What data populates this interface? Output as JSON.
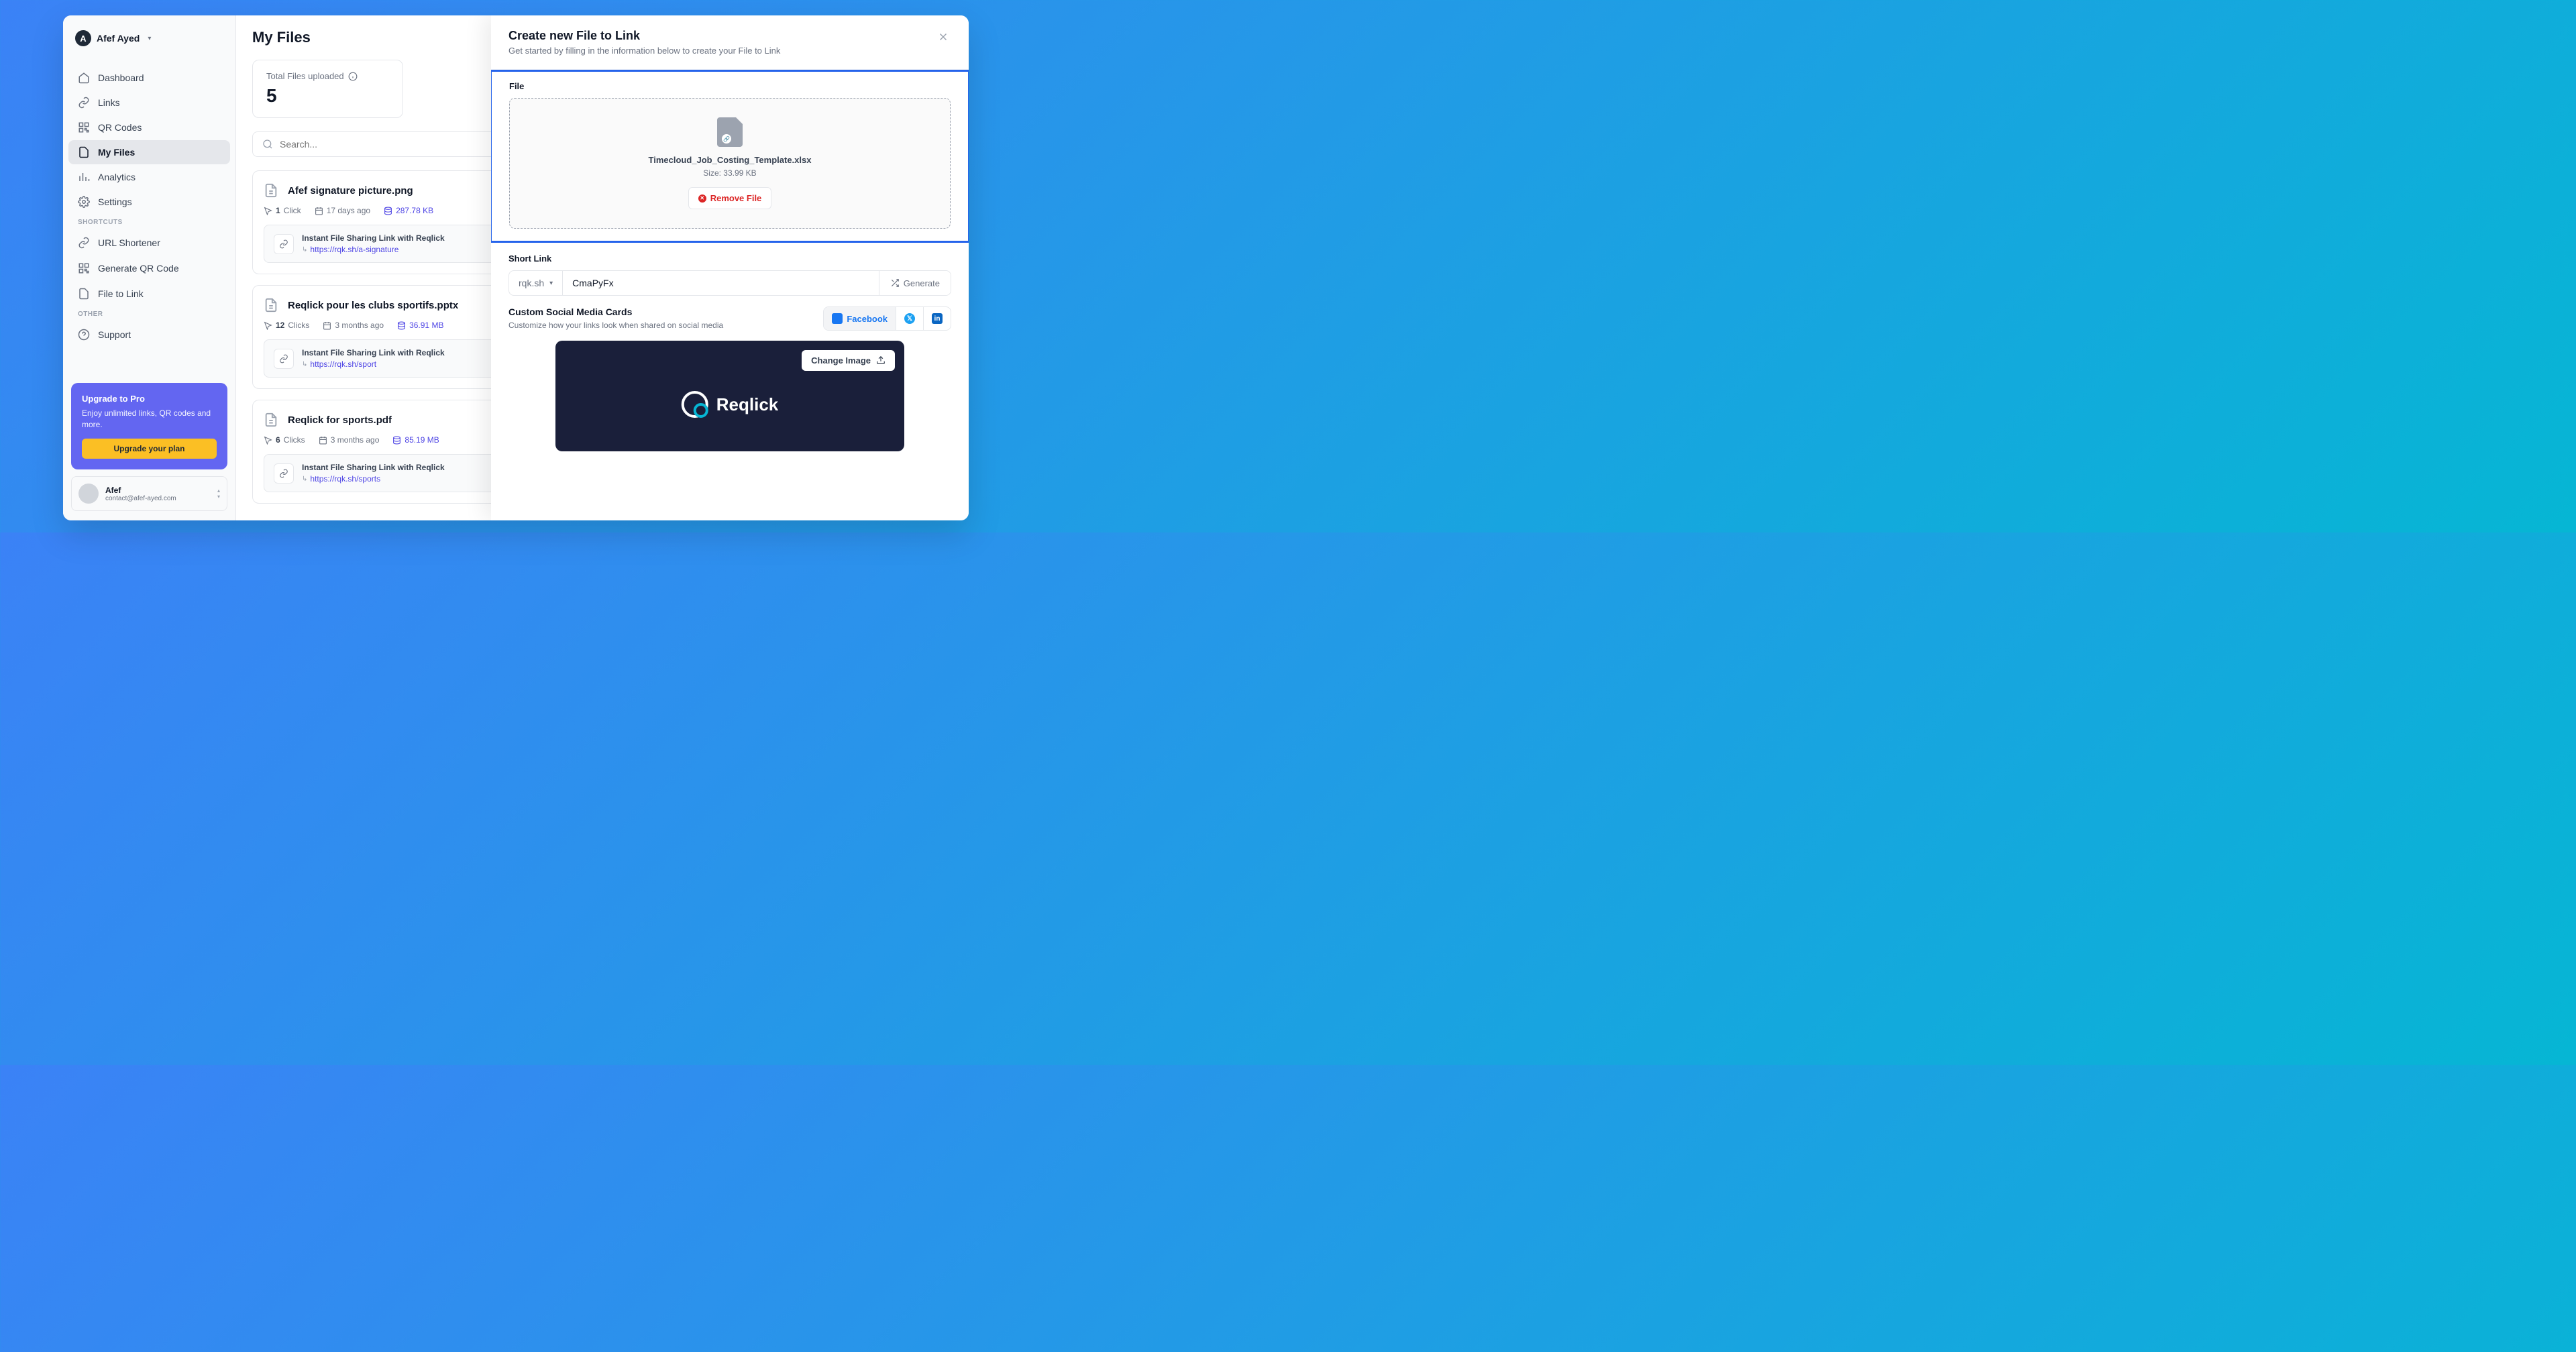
{
  "user": {
    "initial": "A",
    "name": "Afef Ayed"
  },
  "nav": {
    "main": [
      {
        "label": "Dashboard"
      },
      {
        "label": "Links"
      },
      {
        "label": "QR Codes"
      },
      {
        "label": "My Files"
      },
      {
        "label": "Analytics"
      },
      {
        "label": "Settings"
      }
    ],
    "shortcuts_label": "SHORTCUTS",
    "shortcuts": [
      {
        "label": "URL Shortener"
      },
      {
        "label": "Generate QR Code"
      },
      {
        "label": "File to Link"
      }
    ],
    "other_label": "OTHER",
    "other": [
      {
        "label": "Support"
      }
    ]
  },
  "upgrade": {
    "title": "Upgrade to Pro",
    "desc": "Enjoy unlimited links, QR codes and more.",
    "button": "Upgrade your plan"
  },
  "account": {
    "name": "Afef",
    "email": "contact@afef-ayed.com"
  },
  "page": {
    "title": "My Files",
    "stat_label": "Total Files uploaded",
    "stat_value": "5",
    "search_placeholder": "Search..."
  },
  "files": [
    {
      "name": "Afef signature picture.png",
      "clicks": "1",
      "clicks_label": "Click",
      "age": "17 days ago",
      "size": "287.78 KB",
      "share_title": "Instant File Sharing Link with Reqlick",
      "share_link": "https://rqk.sh/a-signature"
    },
    {
      "name": "Reqlick pour les clubs sportifs.pptx",
      "clicks": "12",
      "clicks_label": "Clicks",
      "age": "3 months ago",
      "size": "36.91 MB",
      "share_title": "Instant File Sharing Link with Reqlick",
      "share_link": "https://rqk.sh/sport"
    },
    {
      "name": "Reqlick for sports.pdf",
      "clicks": "6",
      "clicks_label": "Clicks",
      "age": "3 months ago",
      "size": "85.19 MB",
      "share_title": "Instant File Sharing Link with Reqlick",
      "share_link": "https://rqk.sh/sports"
    }
  ],
  "drawer": {
    "title": "Create new File to Link",
    "subtitle": "Get started by filling in the information below to create your File to Link",
    "file_label": "File",
    "uploaded_name": "Timecloud_Job_Costing_Template.xlsx",
    "uploaded_size": "Size: 33.99 KB",
    "remove_btn": "Remove File",
    "shortlink_label": "Short Link",
    "domain": "rqk.sh",
    "slug": "CmaPyFx",
    "generate": "Generate",
    "social_title": "Custom Social Media Cards",
    "social_desc": "Customize how your links look when shared on social media",
    "facebook": "Facebook",
    "change_image": "Change Image",
    "brand": "Reqlick"
  }
}
